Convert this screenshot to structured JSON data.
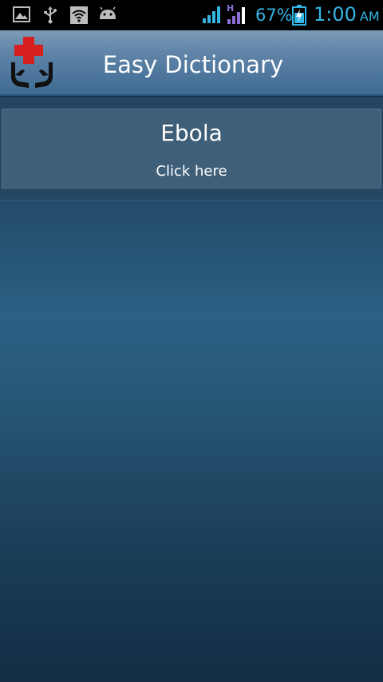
{
  "status_bar": {
    "icons_left": [
      "gallery-icon",
      "usb-icon",
      "wifi-icon",
      "android-icon"
    ],
    "network_type": "H",
    "battery_percent": "67%",
    "time": "1:00",
    "ampm": "AM",
    "accent_color": "#33b5e5"
  },
  "action_bar": {
    "title": "Easy Dictionary",
    "logo_icon": "medical-cross-hands-icon"
  },
  "list": {
    "items": [
      {
        "title": "Ebola",
        "subtitle": "Click here"
      }
    ]
  }
}
